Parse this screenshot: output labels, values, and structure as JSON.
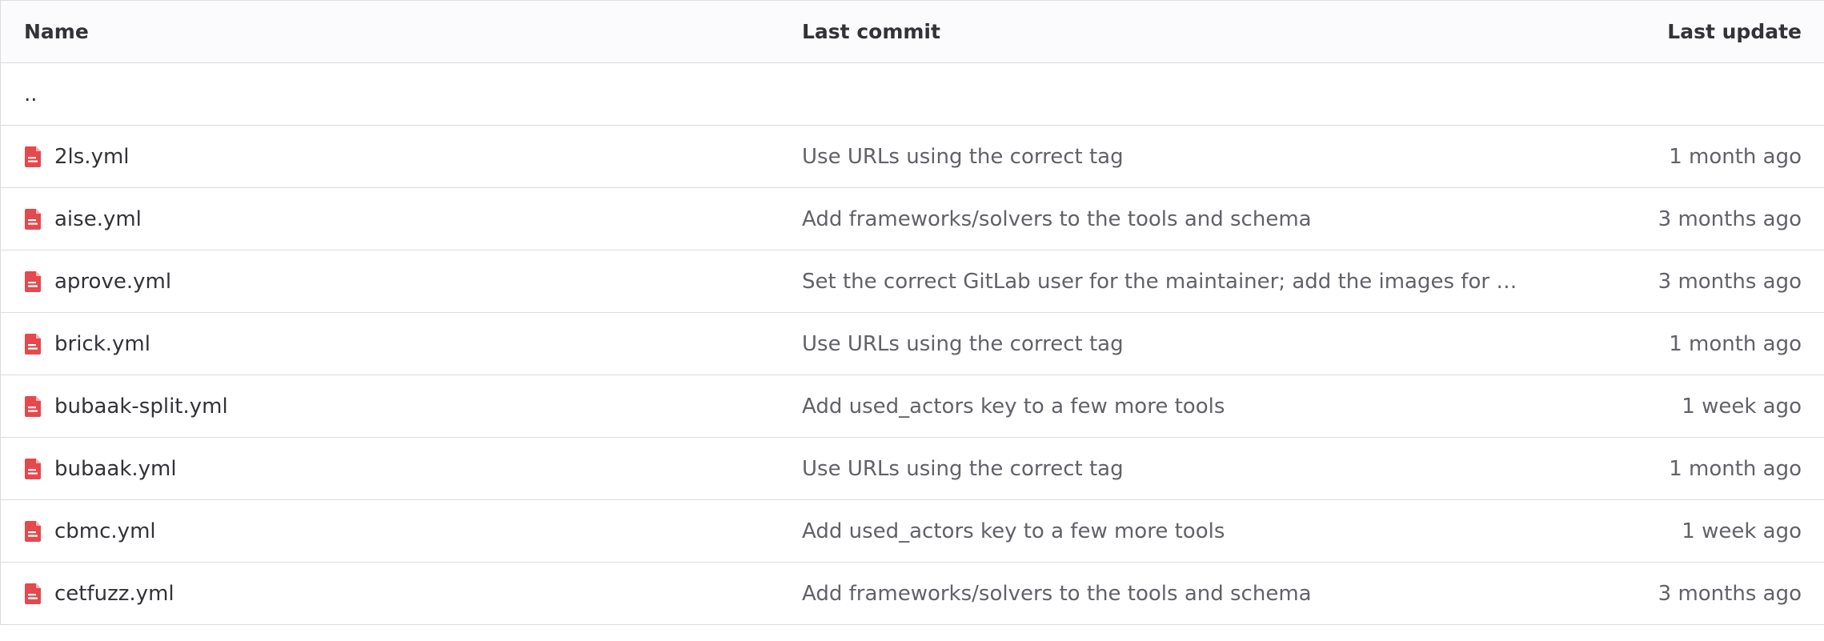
{
  "columns": {
    "name": "Name",
    "last_commit": "Last commit",
    "last_update": "Last update"
  },
  "parent_dir": "..",
  "file_icon": "file-doc-icon",
  "accent_color": "#dd2b0e",
  "rows": [
    {
      "name": "2ls.yml",
      "commit": "Use URLs using the correct tag",
      "updated": "1 month ago"
    },
    {
      "name": "aise.yml",
      "commit": "Add frameworks/solvers to the tools and schema",
      "updated": "3 months ago"
    },
    {
      "name": "aprove.yml",
      "commit": "Set the correct GitLab user for the maintainer; add the images for co...",
      "updated": "3 months ago"
    },
    {
      "name": "brick.yml",
      "commit": "Use URLs using the correct tag",
      "updated": "1 month ago"
    },
    {
      "name": "bubaak-split.yml",
      "commit": "Add used_actors key to a few more tools",
      "updated": "1 week ago"
    },
    {
      "name": "bubaak.yml",
      "commit": "Use URLs using the correct tag",
      "updated": "1 month ago"
    },
    {
      "name": "cbmc.yml",
      "commit": "Add used_actors key to a few more tools",
      "updated": "1 week ago"
    },
    {
      "name": "cetfuzz.yml",
      "commit": "Add frameworks/solvers to the tools and schema",
      "updated": "3 months ago"
    }
  ]
}
